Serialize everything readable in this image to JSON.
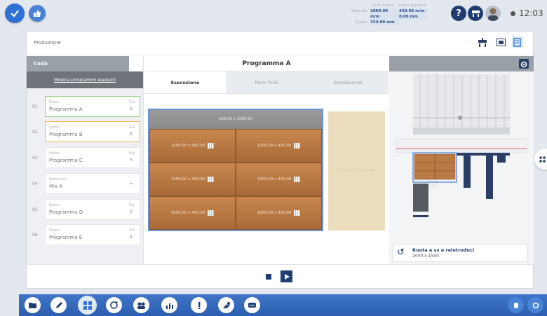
{
  "topbar": {
    "metrics_left": {
      "header": "Carro Lama",
      "rows": [
        {
          "label": "Velocità",
          "value": "1800.00 m/m"
        },
        {
          "label": "Quota",
          "value": "154.00 mm"
        }
      ]
    },
    "metrics_right": {
      "header": "Piano Spintore",
      "rows": [
        {
          "label": "",
          "value": "450.00 m/m"
        },
        {
          "label": "",
          "value": "0.00 mm"
        }
      ]
    },
    "clock": "12:03"
  },
  "panel": {
    "title": "Produzione"
  },
  "queue": {
    "title": "Coda",
    "show_executed": "Mostra programmi eseguiti",
    "items": [
      {
        "num": "01",
        "name_label": "Nome",
        "name": "Programma A",
        "rep_label": "Rip",
        "rep": "5",
        "state": "active-green"
      },
      {
        "num": "02",
        "name_label": "Nome",
        "name": "Programma B",
        "rep_label": "Rip",
        "rep": "5",
        "state": "active-orange"
      },
      {
        "num": "03",
        "name_label": "Nome",
        "name": "Programma C",
        "rep_label": "Rip",
        "rep": "5",
        "state": "normal"
      },
      {
        "num": "04",
        "name_label": "Nome mix",
        "name": "Mix A",
        "rep_label": "",
        "rep": "",
        "state": "mix"
      },
      {
        "num": "05",
        "name_label": "Nome",
        "name": "Programma D",
        "rep_label": "Rip",
        "rep": "5",
        "state": "normal"
      },
      {
        "num": "06",
        "name_label": "Nome",
        "name": "Programma E",
        "rep_label": "Rip",
        "rep": "5",
        "state": "normal"
      }
    ]
  },
  "program": {
    "title": "Programma A",
    "tabs": [
      "Esecuzione",
      "Pezzi finiti",
      "Semilavorati"
    ],
    "active_tab": "Esecuzione",
    "strip_label": "296.00 x 1096.00",
    "pieces": [
      "1000.00 x 400.00",
      "1000.00 x 400.00",
      "1000.00 x 400.00",
      "1000.00 x 400.00",
      "1000.00 x 400.00",
      "1000.00 x 400.00"
    ],
    "scrap_label": "2000.00 x 1500.00"
  },
  "rotation": {
    "title": "Ruota a sx e reintroduci",
    "size": "2000 x 1500"
  },
  "colors": {
    "accent": "#2f6fd6",
    "navy": "#1f3d73",
    "wood": "#b97a45",
    "green": "#8fcf7a",
    "orange": "#f0b54a"
  }
}
